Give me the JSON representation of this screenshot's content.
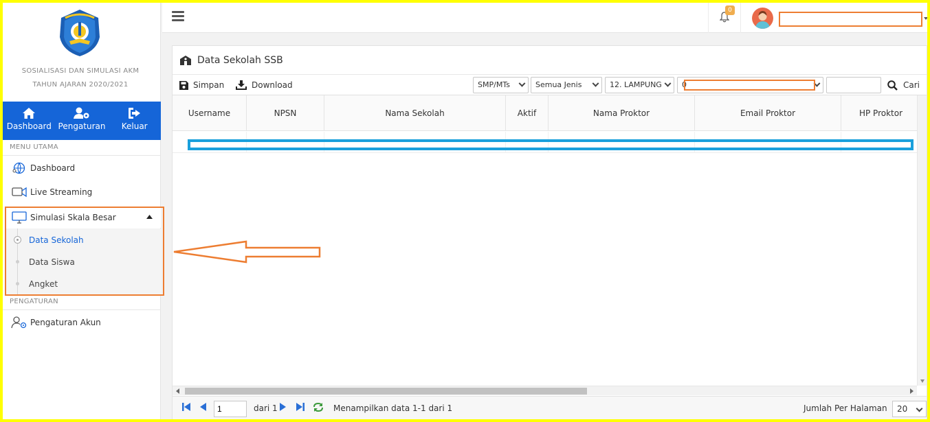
{
  "sidebar": {
    "org_line1": "SOSIALISASI DAN SIMULASI AKM",
    "org_line2": "TAHUN AJARAN 2020/2021",
    "topnav": [
      {
        "label": "Dashboard",
        "icon": "home-icon"
      },
      {
        "label": "Pengaturan",
        "icon": "user-settings-icon"
      },
      {
        "label": "Keluar",
        "icon": "logout-icon"
      }
    ],
    "section_main": "MENU UTAMA",
    "items": [
      {
        "label": "Dashboard",
        "icon": "dashboard-globe-icon"
      },
      {
        "label": "Live Streaming",
        "icon": "video-icon"
      }
    ],
    "simulasi": {
      "label": "Simulasi Skala Besar",
      "icon": "monitor-icon",
      "children": [
        {
          "label": "Data Sekolah",
          "active": true
        },
        {
          "label": "Data Siswa",
          "active": false
        },
        {
          "label": "Angket",
          "active": false
        }
      ]
    },
    "section_settings": "PENGATURAN",
    "settings_item": {
      "label": "Pengaturan Akun",
      "icon": "user-cog-icon"
    }
  },
  "header": {
    "notification_count": "0"
  },
  "panel": {
    "title": "Data Sekolah SSB",
    "toolbar": {
      "save_label": "Simpan",
      "download_label": "Download",
      "filter_level": "SMP/MTs",
      "filter_type": "Semua Jenis",
      "filter_province": "12. LAMPUNG",
      "filter_district": "0",
      "search_value": "",
      "search_label": "Cari"
    },
    "columns": [
      "Username",
      "NPSN",
      "Nama Sekolah",
      "Aktif",
      "Nama Proktor",
      "Email Proktor",
      "HP Proktor"
    ]
  },
  "pager": {
    "page_value": "1",
    "of_text": "dari 1",
    "status": "Menampilkan data 1-1 dari 1",
    "per_page_label": "Jumlah Per Halaman",
    "per_page_value": "20"
  },
  "annotation_colors": {
    "highlight_orange": "#ed7d31",
    "highlight_blue": "#1aa0dc",
    "frame_yellow": "#ffff00",
    "nav_blue": "#1565d8"
  }
}
